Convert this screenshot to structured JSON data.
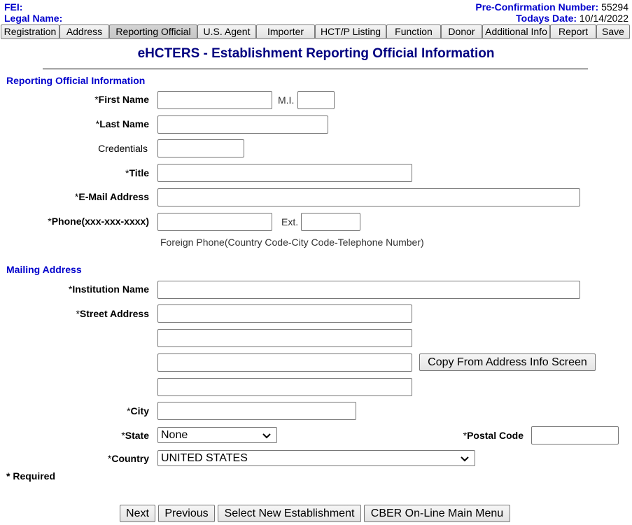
{
  "header": {
    "fei_label": "FEI:",
    "legal_name_label": "Legal Name:",
    "preconf_label": "Pre-Confirmation Number:",
    "preconf_value": "55294",
    "date_label": "Todays Date:",
    "date_value": "10/14/2022"
  },
  "tabs": [
    {
      "label": "Registration"
    },
    {
      "label": "Address"
    },
    {
      "label": "Reporting Official"
    },
    {
      "label": "U.S. Agent"
    },
    {
      "label": "Importer"
    },
    {
      "label": "HCT/P Listing"
    },
    {
      "label": "Function"
    },
    {
      "label": "Donor"
    },
    {
      "label": "Additional Info"
    },
    {
      "label": "Report"
    },
    {
      "label": "Save"
    }
  ],
  "active_tab": "Reporting Official",
  "page_title": "eHCTERS - Establishment Reporting Official Information",
  "official": {
    "section_title": "Reporting Official Information",
    "star": "*",
    "first_name_label": "First Name",
    "mi_label": "M.I.",
    "last_name_label": "Last Name",
    "credentials_label": "Credentials",
    "title_label": "Title",
    "email_label": "E-Mail Address",
    "phone_label": "Phone(xxx-xxx-xxxx)",
    "ext_label": "Ext.",
    "foreign_phone_note": "Foreign Phone(Country Code-City Code-Telephone Number)"
  },
  "mailing": {
    "section_title": "Mailing Address",
    "institution_label": "Institution Name",
    "street_label": "Street Address",
    "copy_button": "Copy From Address Info Screen",
    "city_label": "City",
    "state_label": "State",
    "state_value": "None",
    "postal_label": "Postal Code",
    "country_label": "Country",
    "country_value": "UNITED STATES"
  },
  "required_note": "* Required",
  "footer_buttons": {
    "next": "Next",
    "previous": "Previous",
    "select_new": "Select New Establishment",
    "main_menu": "CBER On-Line Main Menu"
  },
  "colors": {
    "section": "#0000cc",
    "title": "#000080"
  }
}
